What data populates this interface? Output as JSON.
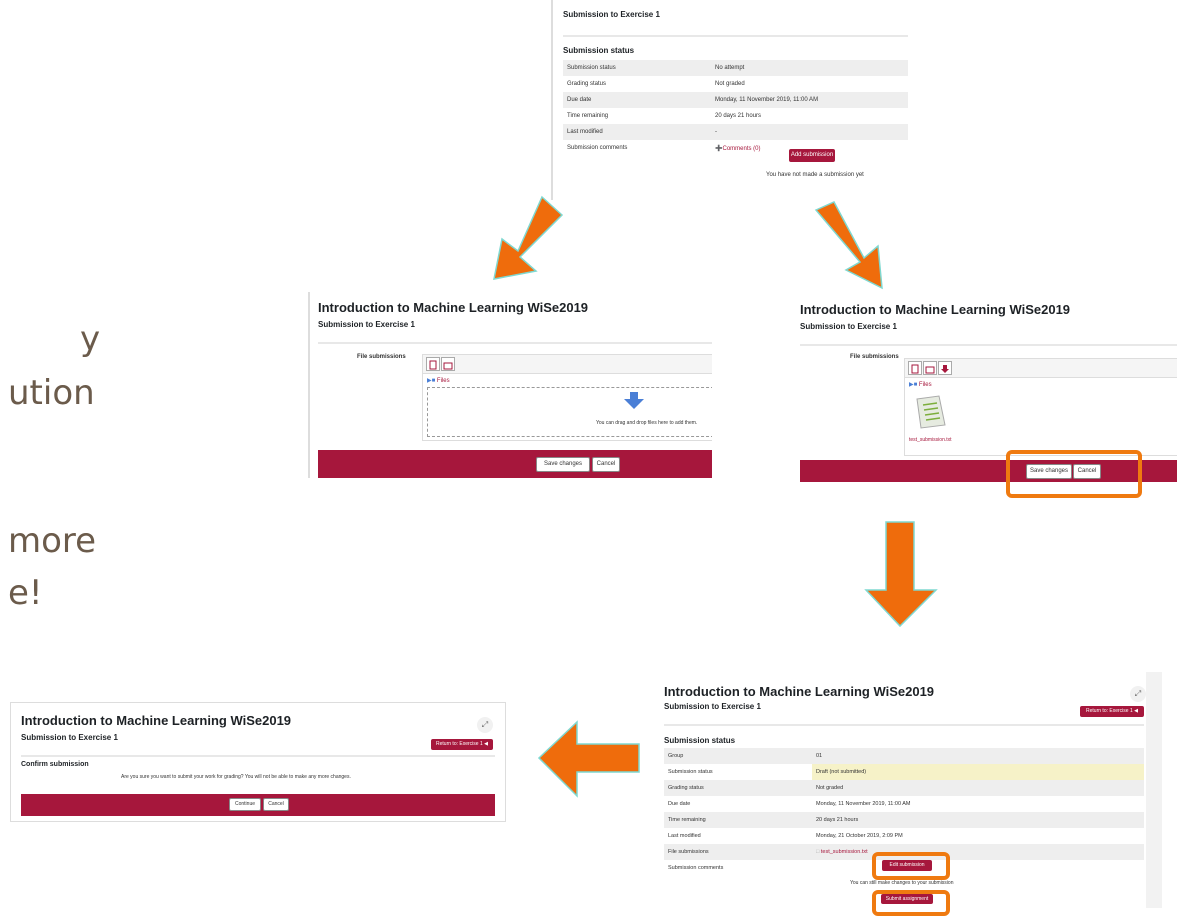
{
  "slide": {
    "partial_text_lines": [
      "y",
      "ution",
      "more",
      "e!"
    ]
  },
  "course_title": "Introduction to Machine Learning WiSe2019",
  "page_subtitle": "Submission to Exercise 1",
  "top_shot": {
    "title": "Submission to Exercise 1",
    "section": "Submission status",
    "rows": [
      {
        "label": "Submission status",
        "value": "No attempt"
      },
      {
        "label": "Grading status",
        "value": "Not graded"
      },
      {
        "label": "Due date",
        "value": "Monday, 11 November 2019, 11:00 AM"
      },
      {
        "label": "Time remaining",
        "value": "20 days 21 hours"
      },
      {
        "label": "Last modified",
        "value": "-"
      },
      {
        "label": "Submission comments",
        "value": "Comments (0)"
      }
    ],
    "add_button": "Add submission",
    "note": "You have not made a submission yet"
  },
  "upload_empty": {
    "label": "File submissions",
    "folder": "Files",
    "drop_hint": "You can drag and drop files here to add them.",
    "save": "Save changes",
    "cancel": "Cancel"
  },
  "upload_file": {
    "label": "File submissions",
    "folder": "Files",
    "file_name": "test_submission.txt",
    "save": "Save changes",
    "cancel": "Cancel"
  },
  "draft_shot": {
    "return_button": "Return to: Exercise 1 ◀",
    "section": "Submission status",
    "rows": [
      {
        "label": "Group",
        "value": "01"
      },
      {
        "label": "Submission status",
        "value": "Draft (not submitted)"
      },
      {
        "label": "Grading status",
        "value": "Not graded"
      },
      {
        "label": "Due date",
        "value": "Monday, 11 November 2019, 11:00 AM"
      },
      {
        "label": "Time remaining",
        "value": "20 days 21 hours"
      },
      {
        "label": "Last modified",
        "value": "Monday, 21 October 2019, 2:09 PM"
      },
      {
        "label": "File submissions",
        "value": "test_submission.txt"
      },
      {
        "label": "Submission comments",
        "value": ""
      }
    ],
    "edit_button": "Edit submission",
    "note": "You can still make changes to your submission",
    "submit_button": "Submit assignment"
  },
  "confirm_shot": {
    "return_button": "Return to: Exercise 1 ◀",
    "section": "Confirm submission",
    "question": "Are you sure you want to submit your work for grading? You will not be able to make any more changes.",
    "continue": "Continue",
    "cancel": "Cancel"
  },
  "colors": {
    "brand_red": "#a6173c",
    "arrow_orange": "#ef6c0c",
    "arrow_outline": "#7fd8d0",
    "highlight_orange": "#ef7a10"
  }
}
